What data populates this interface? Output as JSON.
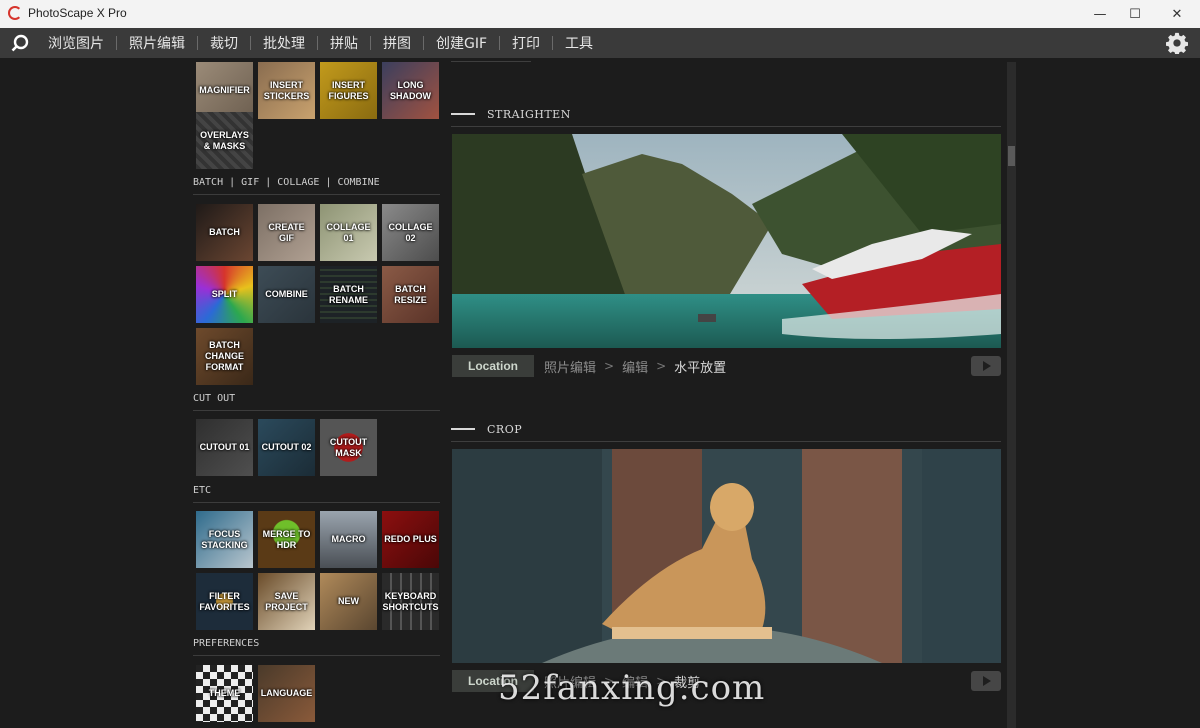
{
  "window": {
    "title": "PhotoScape X Pro"
  },
  "menu": {
    "items": [
      "浏览图片",
      "照片编辑",
      "裁切",
      "批处理",
      "拼贴",
      "拼图",
      "创建GIF",
      "打印",
      "工具"
    ]
  },
  "left_panel": {
    "tiles_top": [
      "MAGNIFIER",
      "INSERT STICKERS",
      "INSERT FIGURES",
      "LONG SHADOW",
      "OVERLAYS & MASKS"
    ],
    "sections": {
      "batch_header": "BATCH | GIF | COLLAGE | COMBINE",
      "batch_tiles": [
        "BATCH",
        "CREATE GIF",
        "COLLAGE 01",
        "COLLAGE 02",
        "SPLIT",
        "COMBINE",
        "BATCH RENAME",
        "BATCH RESIZE",
        "BATCH CHANGE FORMAT"
      ],
      "cutout_header": "CUT OUT",
      "cutout_tiles": [
        "CUTOUT 01",
        "CUTOUT 02",
        "CUTOUT MASK"
      ],
      "etc_header": "ETC",
      "etc_tiles": [
        "FOCUS STACKING",
        "MERGE TO HDR",
        "MACRO",
        "REDO PLUS",
        "FILTER FAVORITES",
        "SAVE PROJECT",
        "NEW",
        "KEYBOARD SHORTCUTS"
      ],
      "pref_header": "PREFERENCES",
      "pref_tiles": [
        "THEME",
        "LANGUAGE"
      ]
    }
  },
  "features": [
    {
      "title": "STRAIGHTEN",
      "location_label": "Location",
      "path": [
        "照片编辑",
        "编辑",
        "水平放置"
      ]
    },
    {
      "title": "CROP",
      "location_label": "Location",
      "path": [
        "照片编辑",
        "编辑",
        "裁剪"
      ]
    }
  ],
  "watermark": "52fanxing.com",
  "colors": {
    "menubar": "#3a3a3a",
    "background": "#1c1c1c",
    "accent": "#d6342c"
  }
}
